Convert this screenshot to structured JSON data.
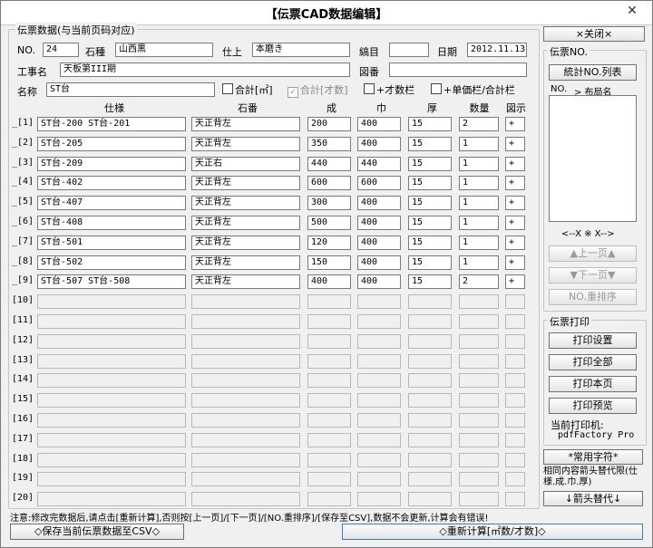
{
  "window": {
    "title": "【伝票CAD数据编辑】",
    "close_glyph": "✕"
  },
  "main_group": {
    "label": "伝票数据(与当前页码对应)"
  },
  "header": {
    "no_label": "NO.",
    "no_value": "24",
    "stone_type_label": "石種",
    "stone_type_value": "山西黒",
    "finish_label": "仕上",
    "finish_value": "本磨き",
    "jobnum_label": "縞目",
    "jobnum_value": "",
    "date_label": "日期",
    "date_value": "2012.11.13",
    "project_label": "工事名",
    "project_value": "天板第III期",
    "drawing_label": "図番",
    "drawing_value": "",
    "name_label": "名称",
    "name_value": "ST台",
    "chk_total_m2": "合計[㎡]",
    "chk_total_count": "合計[才数]",
    "chk_add_count": "+才数栏",
    "chk_unit_price": "+单価栏/合計栏"
  },
  "table": {
    "headers": [
      "仕様",
      "石番",
      "成",
      "巾",
      "厚",
      "数量",
      "図示"
    ],
    "rows": [
      {
        "num": "_[1]",
        "spec": "ST台-200  ST台-201",
        "stone": "天正背左",
        "h": "200",
        "w": "400",
        "t": "15",
        "q": "2",
        "fig": "+"
      },
      {
        "num": "_[2]",
        "spec": "ST台-205",
        "stone": "天正背左",
        "h": "350",
        "w": "400",
        "t": "15",
        "q": "1",
        "fig": "+"
      },
      {
        "num": "_[3]",
        "spec": "ST台-209",
        "stone": "天正右",
        "h": "440",
        "w": "440",
        "t": "15",
        "q": "1",
        "fig": "+"
      },
      {
        "num": "_[4]",
        "spec": "ST台-402",
        "stone": "天正背左",
        "h": "600",
        "w": "600",
        "t": "15",
        "q": "1",
        "fig": "+"
      },
      {
        "num": "_[5]",
        "spec": "ST台-407",
        "stone": "天正背左",
        "h": "300",
        "w": "400",
        "t": "15",
        "q": "1",
        "fig": "+"
      },
      {
        "num": "_[6]",
        "spec": "ST台-408",
        "stone": "天正背左",
        "h": "500",
        "w": "400",
        "t": "15",
        "q": "1",
        "fig": "+"
      },
      {
        "num": "_[7]",
        "spec": "ST台-501",
        "stone": "天正背左",
        "h": "120",
        "w": "400",
        "t": "15",
        "q": "1",
        "fig": "+"
      },
      {
        "num": "_[8]",
        "spec": "ST台-502",
        "stone": "天正背左",
        "h": "150",
        "w": "400",
        "t": "15",
        "q": "1",
        "fig": "+"
      },
      {
        "num": "_[9]",
        "spec": "ST台-507  ST台-508",
        "stone": "天正背左",
        "h": "400",
        "w": "400",
        "t": "15",
        "q": "2",
        "fig": "+"
      },
      {
        "num": "[10]",
        "spec": "",
        "stone": "",
        "h": "",
        "w": "",
        "t": "",
        "q": "",
        "fig": ""
      },
      {
        "num": "[11]",
        "spec": "",
        "stone": "",
        "h": "",
        "w": "",
        "t": "",
        "q": "",
        "fig": ""
      },
      {
        "num": "[12]",
        "spec": "",
        "stone": "",
        "h": "",
        "w": "",
        "t": "",
        "q": "",
        "fig": ""
      },
      {
        "num": "[13]",
        "spec": "",
        "stone": "",
        "h": "",
        "w": "",
        "t": "",
        "q": "",
        "fig": ""
      },
      {
        "num": "[14]",
        "spec": "",
        "stone": "",
        "h": "",
        "w": "",
        "t": "",
        "q": "",
        "fig": ""
      },
      {
        "num": "[15]",
        "spec": "",
        "stone": "",
        "h": "",
        "w": "",
        "t": "",
        "q": "",
        "fig": ""
      },
      {
        "num": "[16]",
        "spec": "",
        "stone": "",
        "h": "",
        "w": "",
        "t": "",
        "q": "",
        "fig": ""
      },
      {
        "num": "[17]",
        "spec": "",
        "stone": "",
        "h": "",
        "w": "",
        "t": "",
        "q": "",
        "fig": ""
      },
      {
        "num": "[18]",
        "spec": "",
        "stone": "",
        "h": "",
        "w": "",
        "t": "",
        "q": "",
        "fig": ""
      },
      {
        "num": "[19]",
        "spec": "",
        "stone": "",
        "h": "",
        "w": "",
        "t": "",
        "q": "",
        "fig": ""
      },
      {
        "num": "[20]",
        "spec": "",
        "stone": "",
        "h": "",
        "w": "",
        "t": "",
        "q": "",
        "fig": ""
      }
    ]
  },
  "side": {
    "close_button": "×关闭×",
    "slip_group_label": "伝票NO.",
    "stats_button": "統計NO.列表",
    "list_header_no": "NO.",
    "list_header_layout": "> 布局名",
    "nav_hint": "<--X ※ X-->",
    "prev_button": "▲上一页▲",
    "next_button": "▼下一页▼",
    "renumber_button": "NO.重排序",
    "print_group_label": "伝票打印",
    "print_settings_button": "打印设置",
    "print_all_button": "打印全部",
    "print_page_button": "打印本页",
    "print_preview_button": "打印预览",
    "current_printer_label": "当前打印机:",
    "current_printer_value": "pdfFactory Pro",
    "common_chars_button": "*常用字符*",
    "arrow_note": "相同内容箭头替代限(仕様.成.巾.厚)",
    "arrow_replace_button": "↓箭头替代↓"
  },
  "footer": {
    "note": "注意:修改完数据后,请点击[重新计算],否则按[上一页]/[下一页]/[NO.重排序]/[保存至CSV],数据不会更新,计算会有错误!",
    "save_csv_button": "◇保存当前伝票数据至CSV◇",
    "recalc_button": "◇重新计算[㎡数/才数]◇"
  }
}
